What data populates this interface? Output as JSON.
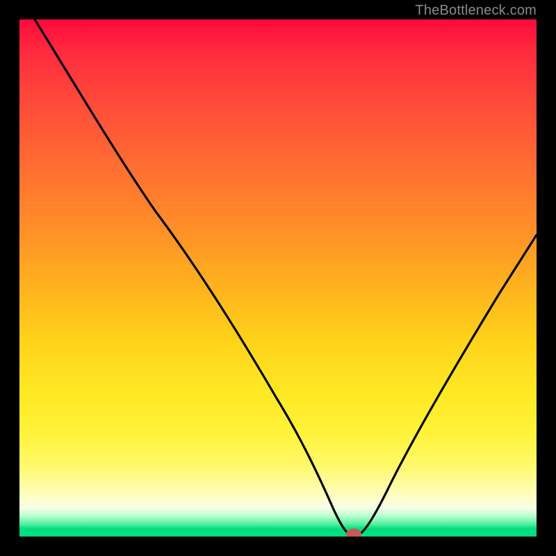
{
  "watermark": "TheBottleneck.com",
  "chart_data": {
    "type": "line",
    "title": "",
    "xlabel": "",
    "ylabel": "",
    "xlim": [
      0,
      100
    ],
    "ylim": [
      0,
      100
    ],
    "grid": false,
    "legend": false,
    "series": [
      {
        "name": "bottleneck-curve",
        "x": [
          3,
          10,
          18,
          26,
          34,
          42,
          50,
          56,
          60,
          62,
          63,
          64,
          66,
          68,
          72,
          80,
          90,
          100
        ],
        "values": [
          100,
          86,
          73,
          63,
          55,
          46,
          35,
          24,
          13,
          6,
          3,
          1,
          1,
          3,
          10,
          26,
          46,
          66
        ]
      }
    ],
    "marker": {
      "x_percent": 64.5,
      "color": "#c95a58"
    },
    "gradient_stops": [
      {
        "pos": 0,
        "color": "#ff0a3c"
      },
      {
        "pos": 50,
        "color": "#ffb31e"
      },
      {
        "pos": 80,
        "color": "#fff33a"
      },
      {
        "pos": 97,
        "color": "#5af0a0"
      },
      {
        "pos": 100,
        "color": "#00de82"
      }
    ]
  }
}
